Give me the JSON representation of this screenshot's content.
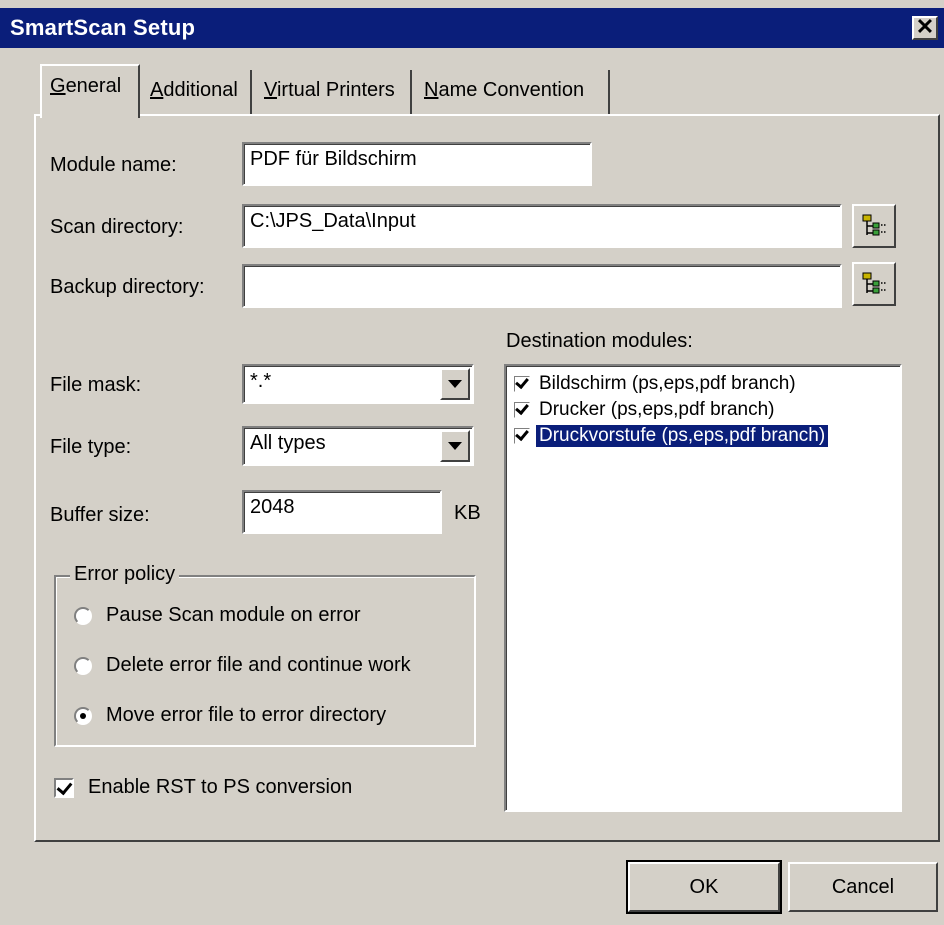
{
  "window": {
    "title": "SmartScan Setup",
    "close_glyph": "✕"
  },
  "tabs": [
    {
      "prefix": "",
      "underlined": "G",
      "rest": "eneral"
    },
    {
      "prefix": "",
      "underlined": "A",
      "rest": "dditional"
    },
    {
      "prefix": "",
      "underlined": "V",
      "rest": "irtual Printers"
    },
    {
      "prefix": "",
      "underlined": "N",
      "rest": "ame Convention"
    }
  ],
  "form": {
    "module_name": {
      "label": "Module name:",
      "value": "PDF für Bildschirm"
    },
    "scan_directory": {
      "label": "Scan directory:",
      "value": "C:\\JPS_Data\\Input"
    },
    "backup_directory": {
      "label": "Backup directory:",
      "value": ""
    },
    "file_mask": {
      "label": "File mask:",
      "value": "*.*"
    },
    "file_type": {
      "label": "File type:",
      "value": "All types"
    },
    "buffer_size": {
      "label": "Buffer size:",
      "value": "2048",
      "unit": "KB"
    }
  },
  "error_policy": {
    "legend": "Error policy",
    "options": [
      {
        "label": "Pause Scan module on error",
        "selected": false
      },
      {
        "label": "Delete error file and continue work",
        "selected": false
      },
      {
        "label": "Move error file to error directory",
        "selected": true
      }
    ]
  },
  "enable_rst": {
    "label": "Enable RST to PS conversion",
    "checked": true
  },
  "destination": {
    "label": "Destination modules:",
    "items": [
      {
        "label": "Bildschirm (ps,eps,pdf branch)",
        "checked": true,
        "selected": false
      },
      {
        "label": "Drucker (ps,eps,pdf branch)",
        "checked": true,
        "selected": false
      },
      {
        "label": "Druckvorstufe (ps,eps,pdf branch)",
        "checked": true,
        "selected": true
      }
    ]
  },
  "buttons": {
    "ok": "OK",
    "cancel": "Cancel"
  },
  "icons": {
    "browse": "folder-tree-icon",
    "dropdown": "chevron-down-icon"
  },
  "colors": {
    "titlebar": "#0a1e7a",
    "face": "#d4d0c8",
    "selection": "#0a1e7a"
  }
}
